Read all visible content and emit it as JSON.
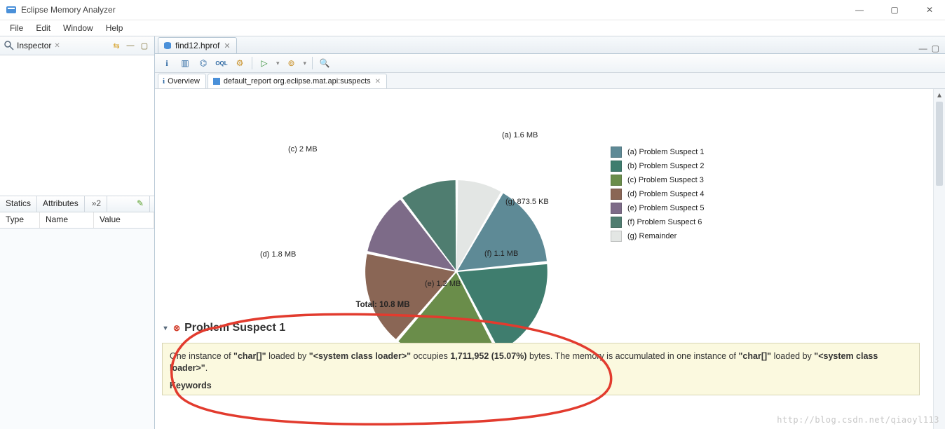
{
  "window": {
    "title": "Eclipse Memory Analyzer",
    "controls": {
      "min": "—",
      "max": "▢",
      "close": "✕"
    }
  },
  "menu": {
    "items": [
      "File",
      "Edit",
      "Window",
      "Help"
    ]
  },
  "inspector": {
    "title": "Inspector",
    "toolbar": {
      "sync": "⇆",
      "min": "—",
      "max": "▢"
    },
    "tabs": {
      "statics": "Statics",
      "attributes": "Attributes",
      "overflow": "»2"
    },
    "cols": {
      "type": "Type",
      "name": "Name",
      "value": "Value"
    }
  },
  "editor": {
    "tab": {
      "label": "find12.hprof"
    },
    "tabs_toolbar": {
      "min": "—",
      "max": "▢"
    },
    "toolbar": {
      "info": "i",
      "histogram": "▥",
      "dominator": "⌬",
      "oql": "OQL",
      "threads": "⚙",
      "run": "▷",
      "query": "⊚",
      "search": "🔍"
    },
    "sub_tabs": {
      "overview": {
        "icon": "i",
        "label": "Overview"
      },
      "report": {
        "label": "default_report  org.eclipse.mat.api:suspects"
      }
    }
  },
  "chart_data": {
    "type": "pie",
    "title": "Total: 10.8 MB",
    "series": [
      {
        "key": "a",
        "name": "Problem Suspect 1",
        "value_mb": 1.6,
        "label": "(a) 1.6 MB",
        "color": "#5e8a96"
      },
      {
        "key": "b",
        "name": "Problem Suspect 2",
        "value_mb": 2.0,
        "label": "(b) Problem Suspect 2",
        "color": "#3f7d6e"
      },
      {
        "key": "c",
        "name": "Problem Suspect 3",
        "value_mb": 2.0,
        "label": "(c) 2 MB",
        "color": "#6a8d4a"
      },
      {
        "key": "d",
        "name": "Problem Suspect 4",
        "value_mb": 1.8,
        "label": "(d) 1.8 MB",
        "color": "#8a6655"
      },
      {
        "key": "e",
        "name": "Problem Suspect 5",
        "value_mb": 1.2,
        "label": "(e) 1.2 MB",
        "color": "#7d6b88"
      },
      {
        "key": "f",
        "name": "Problem Suspect 6",
        "value_mb": 1.1,
        "label": "(f) 1.1 MB",
        "color": "#4f7d70"
      },
      {
        "key": "g",
        "name": "Remainder",
        "value_mb": 0.8735,
        "label": "(g) 873.5 KB",
        "color": "#e3e6e4"
      }
    ],
    "slice_labels": {
      "a": "(a) 1.6 MB",
      "c": "(c) 2 MB",
      "d": "(d) 1.8 MB",
      "e": "(e) 1.2 MB",
      "f": "(f) 1.1 MB",
      "g": "(g) 873.5 KB"
    },
    "legend": [
      {
        "label": "(a) Problem Suspect 1",
        "color": "#5e8a96"
      },
      {
        "label": "(b) Problem Suspect 2",
        "color": "#3f7d6e"
      },
      {
        "label": "(c) Problem Suspect 3",
        "color": "#6a8d4a"
      },
      {
        "label": "(d) Problem Suspect 4",
        "color": "#8a6655"
      },
      {
        "label": "(e) Problem Suspect 5",
        "color": "#7d6b88"
      },
      {
        "label": "(f) Problem Suspect 6",
        "color": "#4f7d70"
      },
      {
        "label": "(g) Remainder",
        "color": "#e3e6e4"
      }
    ]
  },
  "suspect": {
    "heading": "Problem Suspect 1",
    "text_parts": {
      "p0": "One instance of ",
      "p1": "\"char[]\"",
      "p2": " loaded by ",
      "p3": "\"<system class loader>\"",
      "p4": " occupies ",
      "p5": "1,711,952 (15.07%)",
      "p6": " bytes. The memory is accumulated in one instance of ",
      "p7": "\"char[]\"",
      "p8": " loaded by ",
      "p9": "\"<system class loader>\"",
      "p10": "."
    },
    "keywords_label": "Keywords"
  },
  "watermark": "http://blog.csdn.net/qiaoyl113"
}
